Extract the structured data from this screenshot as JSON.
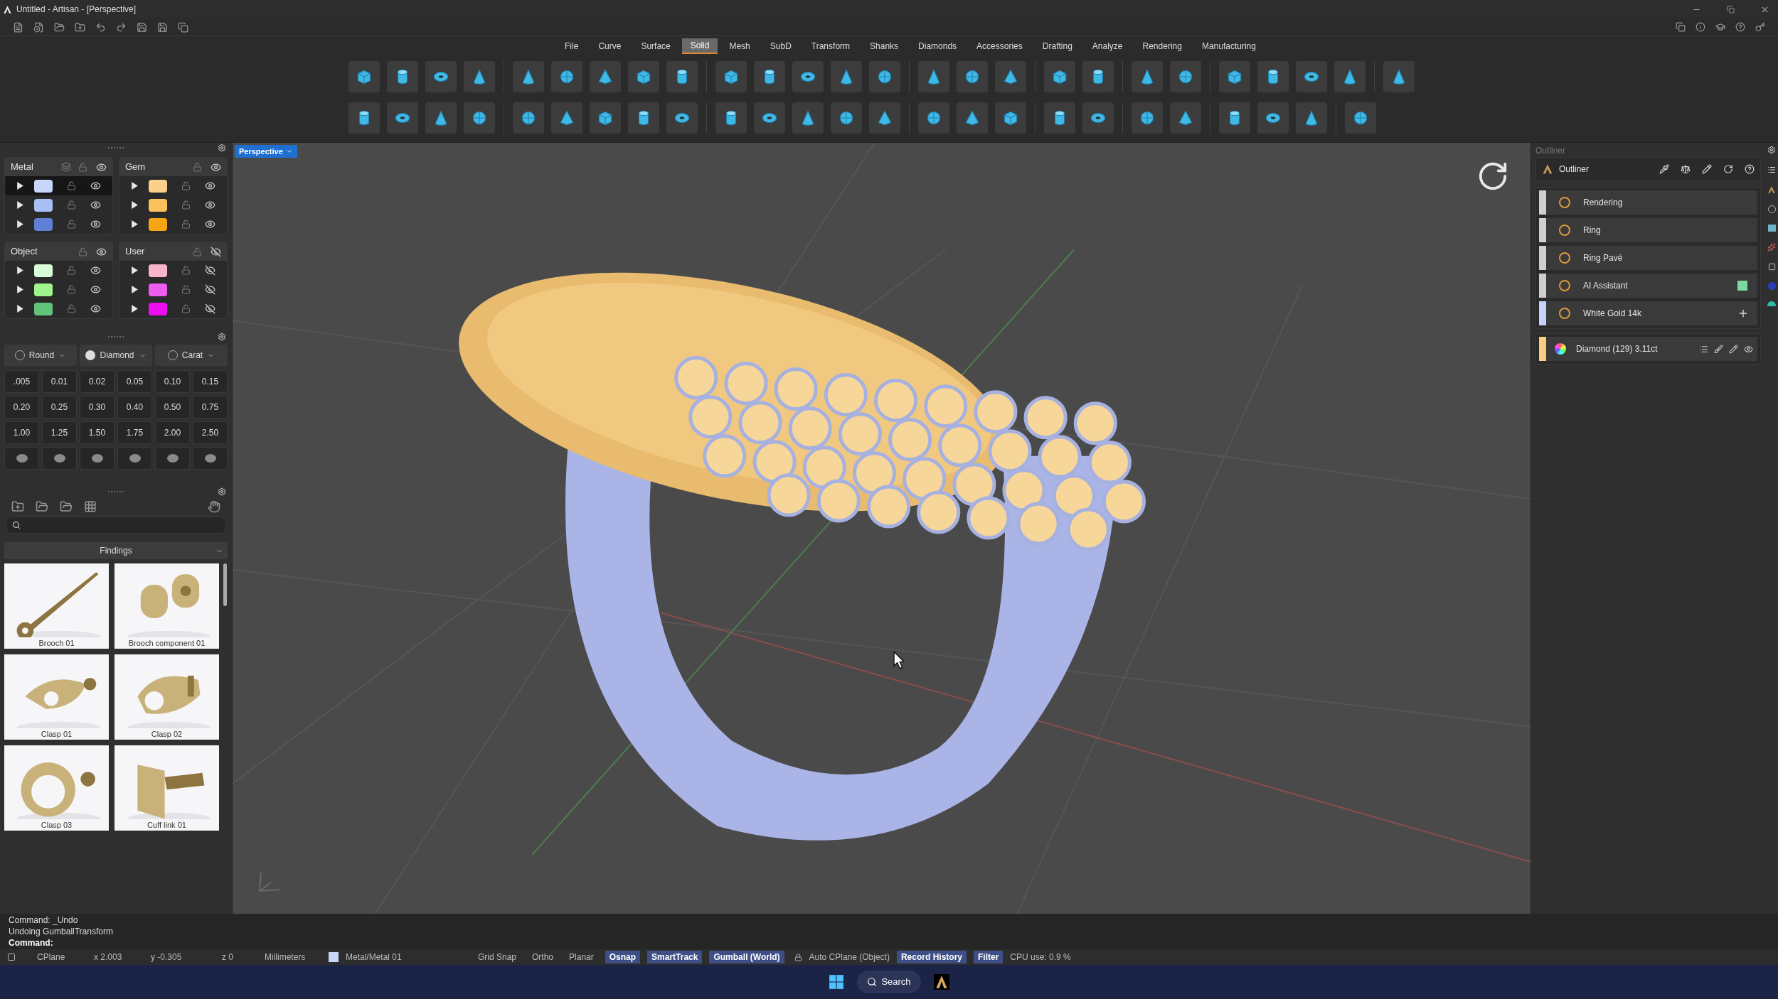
{
  "window": {
    "title": "Untitled - Artisan - [Perspective]"
  },
  "menu": [
    {
      "label": "File",
      "selected": false
    },
    {
      "label": "Curve",
      "selected": false
    },
    {
      "label": "Surface",
      "selected": false
    },
    {
      "label": "Solid",
      "selected": true
    },
    {
      "label": "Mesh",
      "selected": false
    },
    {
      "label": "SubD",
      "selected": false
    },
    {
      "label": "Transform",
      "selected": false
    },
    {
      "label": "Shanks",
      "selected": false
    },
    {
      "label": "Diamonds",
      "selected": false
    },
    {
      "label": "Accessories",
      "selected": false
    },
    {
      "label": "Drafting",
      "selected": false
    },
    {
      "label": "Analyze",
      "selected": false
    },
    {
      "label": "Rendering",
      "selected": false
    },
    {
      "label": "Manufacturing",
      "selected": false
    }
  ],
  "layers": [
    {
      "name": "Metal",
      "visible": true,
      "rows": [
        {
          "color": "#c8d6fa",
          "visible": true,
          "selected": true
        },
        {
          "color": "#a7bff5",
          "visible": true,
          "selected": false
        },
        {
          "color": "#5f80d6",
          "visible": true,
          "selected": false
        }
      ]
    },
    {
      "name": "Gem",
      "visible": true,
      "rows": [
        {
          "color": "#fbd08a",
          "visible": true,
          "selected": false
        },
        {
          "color": "#f9c25a",
          "visible": true,
          "selected": false
        },
        {
          "color": "#f7a512",
          "visible": true,
          "selected": false
        }
      ]
    },
    {
      "name": "Object",
      "visible": true,
      "rows": [
        {
          "color": "#d8fbd8",
          "visible": true,
          "selected": false
        },
        {
          "color": "#9ef58e",
          "visible": true,
          "selected": false
        },
        {
          "color": "#62c47a",
          "visible": true,
          "selected": false
        }
      ]
    },
    {
      "name": "User",
      "visible": false,
      "rows": [
        {
          "color": "#f8b4c8",
          "visible": false,
          "selected": false
        },
        {
          "color": "#ee5cf0",
          "visible": false,
          "selected": false
        },
        {
          "color": "#ee0cf0",
          "visible": false,
          "selected": false
        }
      ]
    }
  ],
  "gem_selector": {
    "dropdowns": [
      "Round",
      "Diamond",
      "Carat"
    ],
    "sizes": [
      ".005",
      "0.01",
      "0.02",
      "0.05",
      "0.10",
      "0.15",
      "0.20",
      "0.25",
      "0.30",
      "0.40",
      "0.50",
      "0.75",
      "1.00",
      "1.25",
      "1.50",
      "1.75",
      "2.00",
      "2.50"
    ]
  },
  "library": {
    "section": "Findings",
    "items": [
      "Brooch 01",
      "Brooch component 01",
      "Clasp 01",
      "Clasp 02",
      "Clasp 03",
      "Cuff link 01"
    ]
  },
  "viewport": {
    "label": "Perspective"
  },
  "outliner": {
    "panel_title": "Outliner",
    "header": "Outliner",
    "items": [
      {
        "label": "Rendering",
        "color": "#cfcfcf",
        "kind": "plain"
      },
      {
        "label": "Ring",
        "color": "#cfcfcf",
        "kind": "plain"
      },
      {
        "label": "Ring Pavé",
        "color": "#cfcfcf",
        "kind": "plain"
      },
      {
        "label": "AI Assistant",
        "color": "#cfcfcf",
        "kind": "swatch"
      },
      {
        "label": "White Gold 14k",
        "color": "#c5d2fb",
        "kind": "addable"
      }
    ],
    "material": {
      "label": "Diamond (129) 3.11ct",
      "color": "#f8cd7f"
    }
  },
  "command": {
    "history": [
      "Command: _Undo",
      "Undoing GumballTransform"
    ],
    "prompt": "Command:"
  },
  "status_bar": {
    "cplane": "CPlane",
    "x": "x 2.003",
    "y": "y -0.305",
    "z": "z 0",
    "units": "Millimeters",
    "layer": {
      "label": "Metal/Metal 01",
      "color": "#c8d6fa"
    },
    "toggles": [
      {
        "label": "Grid Snap",
        "on": false
      },
      {
        "label": "Ortho",
        "on": false
      },
      {
        "label": "Planar",
        "on": false
      },
      {
        "label": "Osnap",
        "on": true
      },
      {
        "label": "SmartTrack",
        "on": true
      },
      {
        "label": "Gumball (World)",
        "on": true
      }
    ],
    "auto_cplane": "Auto CPlane (Object)",
    "toggles_2": [
      {
        "label": "Record History",
        "on": true
      },
      {
        "label": "Filter",
        "on": true
      }
    ],
    "cpu": "CPU use: 0.9 %"
  },
  "taskbar": {
    "search": "Search"
  }
}
